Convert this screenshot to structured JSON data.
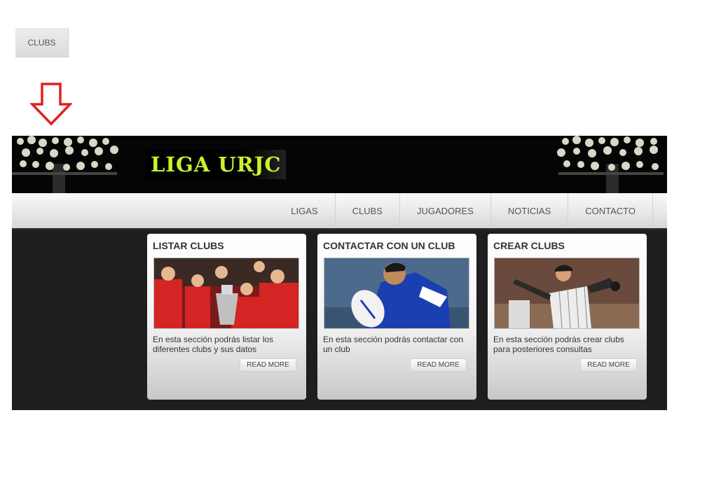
{
  "top_tab": {
    "label": "CLUBS"
  },
  "header": {
    "logo_text": "LIGA URJC"
  },
  "nav": {
    "items": [
      {
        "label": "LIGAS"
      },
      {
        "label": "CLUBS"
      },
      {
        "label": "JUGADORES"
      },
      {
        "label": "NOTICIAS"
      },
      {
        "label": "CONTACTO"
      }
    ]
  },
  "cards": [
    {
      "title": "LISTAR CLUBS",
      "description": "En esta sección podrás listar los diferentes clubs y sus datos",
      "button": "READ MORE"
    },
    {
      "title": "CONTACTAR CON UN CLUB",
      "description": "En esta sección podrás contactar con un club",
      "button": "READ MORE"
    },
    {
      "title": "CREAR CLUBS",
      "description": "En esta sección podrás crear clubs para posteriores consultas",
      "button": "READ MORE"
    }
  ],
  "colors": {
    "arrow": "#e02020",
    "logo_text": "#c6f42c",
    "site_bg": "#1e1e1e",
    "header_bg": "#050505"
  }
}
